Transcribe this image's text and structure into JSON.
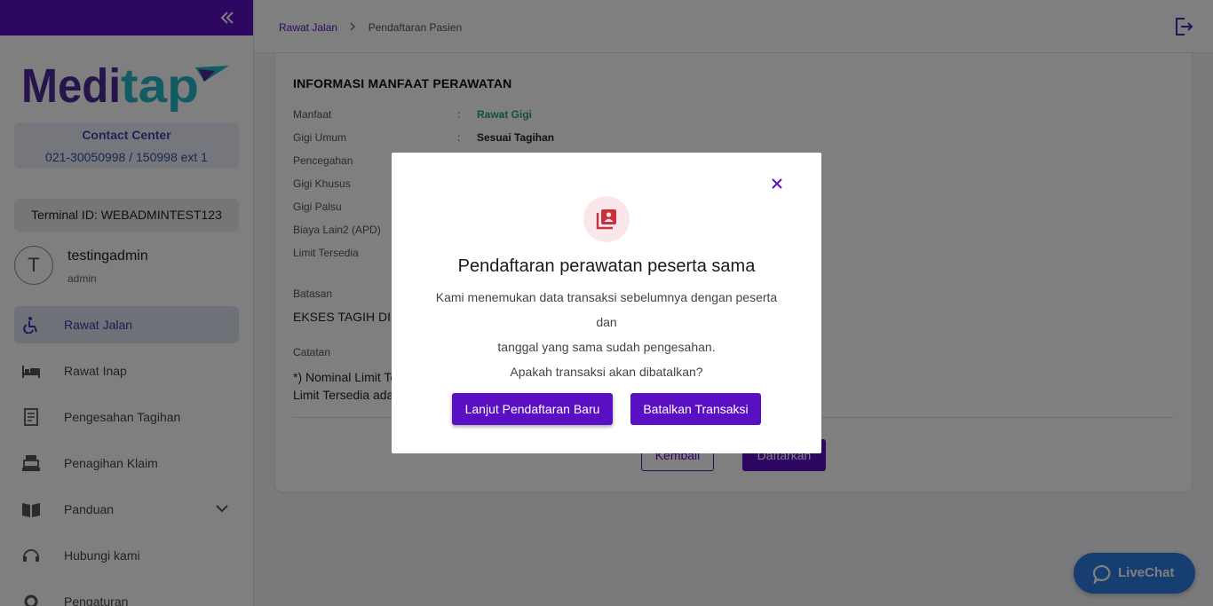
{
  "sidebar": {
    "logo_text": "Meditap",
    "contact": {
      "title": "Contact Center",
      "phone": "021-30050998 / 150998 ext 1"
    },
    "terminal": "Terminal ID: WEBADMINTEST123",
    "user": {
      "initial": "T",
      "name": "testingadmin",
      "role": "admin"
    },
    "items": [
      {
        "label": "Rawat Jalan",
        "icon": "wheelchair-icon",
        "active": true
      },
      {
        "label": "Rawat Inap",
        "icon": "bed-icon"
      },
      {
        "label": "Pengesahan Tagihan",
        "icon": "receipt-icon"
      },
      {
        "label": "Penagihan Klaim",
        "icon": "cash-register-icon"
      },
      {
        "label": "Panduan",
        "icon": "book-icon",
        "expandable": true
      },
      {
        "label": "Hubungi kami",
        "icon": "headset-icon"
      },
      {
        "label": "Pengaturan",
        "icon": "gear-icon"
      }
    ]
  },
  "header": {
    "breadcrumb": {
      "parent": "Rawat Jalan",
      "current": "Pendaftaran Pasien"
    }
  },
  "main": {
    "section_title": "INFORMASI MANFAAT PERAWATAN",
    "rows": [
      {
        "label": "Manfaat",
        "colon": ":",
        "value": "Rawat Gigi"
      },
      {
        "label": "Gigi Umum",
        "colon": ":",
        "value": "Sesuai Tagihan"
      },
      {
        "label": "Pencegahan"
      },
      {
        "label": "Gigi Khusus"
      },
      {
        "label": "Gigi Palsu"
      },
      {
        "label": "Biaya Lain2 (APD)"
      },
      {
        "label": "Limit Tersedia"
      }
    ],
    "batasan_label": "Batasan",
    "batasan_value": "EKSES TAGIH DI T",
    "catatan_label": "Catatan",
    "catatan_line1": "*) Nominal Limit Te",
    "catatan_line2": "Limit Tersedia ada",
    "back_label": "Kembali",
    "submit_label": "Daftarkan"
  },
  "modal": {
    "title": "Pendaftaran perawatan peserta sama",
    "line1": "Kami menemukan data transaksi sebelumnya dengan peserta dan",
    "line2": "tanggal yang sama sudah pengesahan.",
    "line3": "Apakah transaksi akan dibatalkan?",
    "continue_label": "Lanjut Pendaftaran Baru",
    "cancel_label": "Batalkan Transaksi",
    "icon": "patient-list-icon"
  },
  "livechat": {
    "label": "LiveChat"
  },
  "colors": {
    "primary": "#5b0fc2",
    "accent_green": "#27a46a",
    "livechat": "#2f7de1"
  }
}
